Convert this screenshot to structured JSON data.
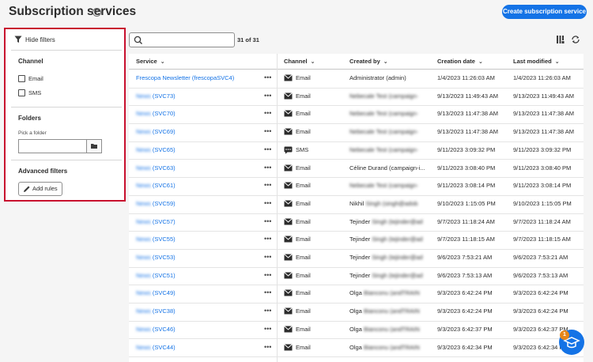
{
  "page": {
    "title": "Subscription services",
    "create_button": "Create subscription service"
  },
  "filters": {
    "hide_label": "Hide filters",
    "channel_title": "Channel",
    "channel_options": [
      "Email",
      "SMS"
    ],
    "folders_title": "Folders",
    "folder_label": "Pick a folder",
    "advanced_title": "Advanced filters",
    "add_rules_label": "Add rules"
  },
  "toolbar": {
    "search_placeholder": "",
    "count_label": "31 of 31"
  },
  "table": {
    "headers": [
      "Service",
      "Channel",
      "Created by",
      "Creation date",
      "Last modified"
    ],
    "rows": [
      {
        "service_name": "Frescopa Newsletter",
        "service_id": "(frescopaSVC4)",
        "channel": "Email",
        "channel_icon": "email-icon",
        "created_by": "Administrator (admin)",
        "created_by_hidden": "",
        "creation_date": "1/4/2023 11:26:03 AM",
        "last_modified": "1/4/2023 11:26:03 AM"
      },
      {
        "service_name": "News",
        "service_id": "(SVC73)",
        "channel": "Email",
        "channel_icon": "email-icon",
        "created_by": "",
        "created_by_hidden": "Nebecale Test (campaign-",
        "creation_date": "9/13/2023 11:49:43 AM",
        "last_modified": "9/13/2023 11:49:43 AM"
      },
      {
        "service_name": "News",
        "service_id": "(SVC70)",
        "channel": "Email",
        "channel_icon": "email-icon",
        "created_by": "",
        "created_by_hidden": "Nebecale Test (campaign-",
        "creation_date": "9/13/2023 11:47:38 AM",
        "last_modified": "9/13/2023 11:47:38 AM"
      },
      {
        "service_name": "News",
        "service_id": "(SVC69)",
        "channel": "Email",
        "channel_icon": "email-icon",
        "created_by": "",
        "created_by_hidden": "Nebecale Test (campaign-",
        "creation_date": "9/13/2023 11:47:38 AM",
        "last_modified": "9/13/2023 11:47:38 AM"
      },
      {
        "service_name": "News",
        "service_id": "(SVC65)",
        "channel": "SMS",
        "channel_icon": "sms-icon",
        "created_by": "",
        "created_by_hidden": "Nebecale Test (campaign-",
        "creation_date": "9/11/2023 3:09:32 PM",
        "last_modified": "9/11/2023 3:09:32 PM"
      },
      {
        "service_name": "News",
        "service_id": "(SVC63)",
        "channel": "Email",
        "channel_icon": "email-icon",
        "created_by": "Céline Durand (campaign-i...",
        "created_by_hidden": "",
        "creation_date": "9/11/2023 3:08:40 PM",
        "last_modified": "9/11/2023 3:08:40 PM"
      },
      {
        "service_name": "News",
        "service_id": "(SVC61)",
        "channel": "Email",
        "channel_icon": "email-icon",
        "created_by": "",
        "created_by_hidden": "Nebecale Test (campaign-",
        "creation_date": "9/11/2023 3:08:14 PM",
        "last_modified": "9/11/2023 3:08:14 PM"
      },
      {
        "service_name": "News",
        "service_id": "(SVC59)",
        "channel": "Email",
        "channel_icon": "email-icon",
        "created_by": "Nikhil",
        "created_by_hidden": "Singh (singh@adob",
        "creation_date": "9/10/2023 1:15:05 PM",
        "last_modified": "9/10/2023 1:15:05 PM"
      },
      {
        "service_name": "News",
        "service_id": "(SVC57)",
        "channel": "Email",
        "channel_icon": "email-icon",
        "created_by": "Tejinder",
        "created_by_hidden": "Singh (tejinder@ad",
        "creation_date": "9/7/2023 11:18:24 AM",
        "last_modified": "9/7/2023 11:18:24 AM"
      },
      {
        "service_name": "News",
        "service_id": "(SVC55)",
        "channel": "Email",
        "channel_icon": "email-icon",
        "created_by": "Tejinder",
        "created_by_hidden": "Singh (tejinder@ad",
        "creation_date": "9/7/2023 11:18:15 AM",
        "last_modified": "9/7/2023 11:18:15 AM"
      },
      {
        "service_name": "News",
        "service_id": "(SVC53)",
        "channel": "Email",
        "channel_icon": "email-icon",
        "created_by": "Tejinder",
        "created_by_hidden": "Singh (tejinder@ad",
        "creation_date": "9/6/2023 7:53:21 AM",
        "last_modified": "9/6/2023 7:53:21 AM"
      },
      {
        "service_name": "News",
        "service_id": "(SVC51)",
        "channel": "Email",
        "channel_icon": "email-icon",
        "created_by": "Tejinder",
        "created_by_hidden": "Singh (tejinder@ad",
        "creation_date": "9/6/2023 7:53:13 AM",
        "last_modified": "9/6/2023 7:53:13 AM"
      },
      {
        "service_name": "News",
        "service_id": "(SVC49)",
        "channel": "Email",
        "channel_icon": "email-icon",
        "created_by": "Olga",
        "created_by_hidden": "Bianconu (andTRAIN",
        "creation_date": "9/3/2023 6:42:24 PM",
        "last_modified": "9/3/2023 6:42:24 PM"
      },
      {
        "service_name": "News",
        "service_id": "(SVC38)",
        "channel": "Email",
        "channel_icon": "email-icon",
        "created_by": "Olga",
        "created_by_hidden": "Bianconu (andTRAIN",
        "creation_date": "9/3/2023 6:42:24 PM",
        "last_modified": "9/3/2023 6:42:24 PM"
      },
      {
        "service_name": "News",
        "service_id": "(SVC46)",
        "channel": "Email",
        "channel_icon": "email-icon",
        "created_by": "Olga",
        "created_by_hidden": "Bianconu (andTRAIN",
        "creation_date": "9/3/2023 6:42:37 PM",
        "last_modified": "9/3/2023 6:42:37 PM"
      },
      {
        "service_name": "News",
        "service_id": "(SVC44)",
        "channel": "Email",
        "channel_icon": "email-icon",
        "created_by": "Olga",
        "created_by_hidden": "Bianconu (andTRAIN",
        "creation_date": "9/3/2023 6:42:34 PM",
        "last_modified": "9/3/2023 6:42:34 PM"
      }
    ]
  },
  "fab": {
    "badge": "1"
  },
  "colors": {
    "accent": "#1473e6",
    "highlight_border": "#c8102e",
    "badge": "#e68619"
  }
}
